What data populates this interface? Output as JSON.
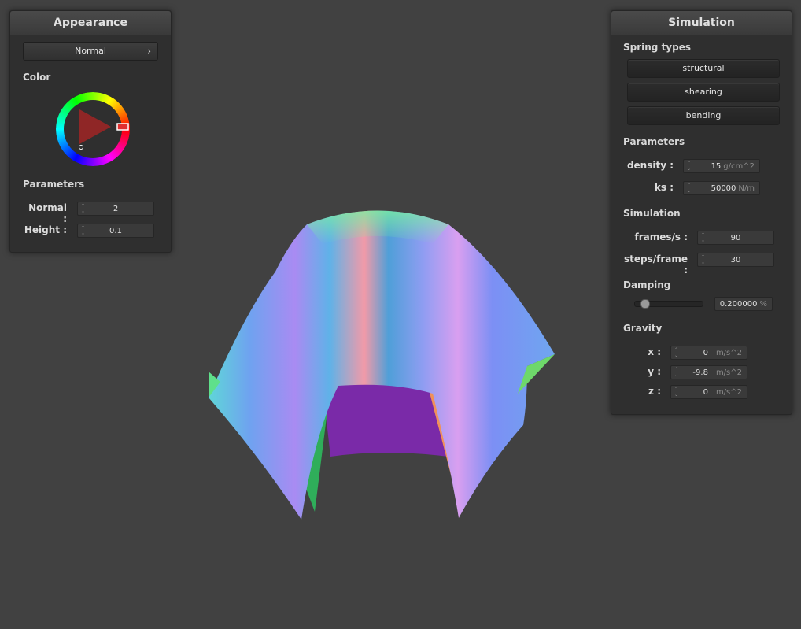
{
  "appearance": {
    "title": "Appearance",
    "shader_select": "Normal",
    "color_label": "Color",
    "parameters_label": "Parameters",
    "normal": {
      "label": "Normal :",
      "value": "2"
    },
    "height": {
      "label": "Height :",
      "value": "0.1"
    }
  },
  "simulation": {
    "title": "Simulation",
    "spring_types_label": "Spring types",
    "spring_buttons": [
      "structural",
      "shearing",
      "bending"
    ],
    "parameters_label": "Parameters",
    "density": {
      "label": "density :",
      "value": "15",
      "unit": "g/cm^2"
    },
    "ks": {
      "label": "ks :",
      "value": "50000",
      "unit": "N/m"
    },
    "simulation_label": "Simulation",
    "fps": {
      "label": "frames/s :",
      "value": "90"
    },
    "steps": {
      "label": "steps/frame :",
      "value": "30"
    },
    "damping_label": "Damping",
    "damping": {
      "value": "0.200000",
      "unit": "%",
      "fraction": 0.2
    },
    "gravity_label": "Gravity",
    "gx": {
      "label": "x :",
      "value": "0",
      "unit": "m/s^2"
    },
    "gy": {
      "label": "y :",
      "value": "-9.8",
      "unit": "m/s^2"
    },
    "gz": {
      "label": "z :",
      "value": "0",
      "unit": "m/s^2"
    }
  },
  "colors": {
    "background": "#414141",
    "panel": "#2f2f2f",
    "selected_color": "#e03030"
  }
}
